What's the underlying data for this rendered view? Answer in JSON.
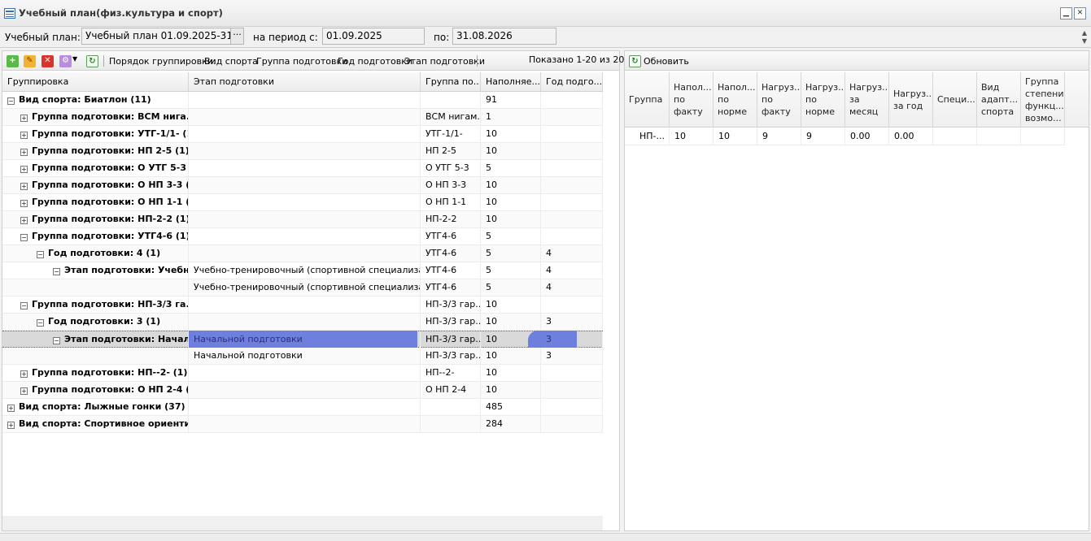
{
  "window": {
    "title": "Учебный план(физ.культура и спорт)",
    "min_label": "▁",
    "close_label": "✕"
  },
  "params": {
    "plan_label": "Учебный план:",
    "plan_value": "Учебный план 01.09.2025-31.08.2026",
    "dots_label": "···",
    "period_label": "на период с:",
    "date_from": "01.09.2025",
    "to_label": "по:",
    "date_to": "31.08.2026"
  },
  "left_toolbar": {
    "grouping_label": "Порядок группировки:",
    "groups": [
      "Вид спорта",
      "Группа подготовки",
      "Год подготовки",
      "Этап подготовки"
    ],
    "shown": "Показано 1-20 из 20"
  },
  "left_grid": {
    "headers": [
      "Группировка",
      "Этап подготовки",
      "Группа по...",
      "Наполняе...",
      "Год подго..."
    ],
    "rows": [
      {
        "lvl": 0,
        "exp": "−",
        "group": "Вид спорта: Биатлон (11)",
        "stage": "",
        "grp": "",
        "fill": "91",
        "year": ""
      },
      {
        "lvl": 1,
        "exp": "+",
        "group": "Группа подготовки: ВСМ нига...",
        "stage": "",
        "grp": "ВСМ нигам...",
        "fill": "1",
        "year": ""
      },
      {
        "lvl": 1,
        "exp": "+",
        "group": "Группа подготовки: УТГ-1/1- (1)",
        "stage": "",
        "grp": "УТГ-1/1-",
        "fill": "10",
        "year": ""
      },
      {
        "lvl": 1,
        "exp": "+",
        "group": "Группа подготовки: НП 2-5 (1)",
        "stage": "",
        "grp": "НП 2-5",
        "fill": "10",
        "year": ""
      },
      {
        "lvl": 1,
        "exp": "+",
        "group": "Группа подготовки: О УТГ 5-3 ...",
        "stage": "",
        "grp": "О УТГ 5-3",
        "fill": "5",
        "year": ""
      },
      {
        "lvl": 1,
        "exp": "+",
        "group": "Группа подготовки: О НП 3-3 (...",
        "stage": "",
        "grp": "О НП 3-3",
        "fill": "10",
        "year": ""
      },
      {
        "lvl": 1,
        "exp": "+",
        "group": "Группа подготовки: О НП 1-1 (...",
        "stage": "",
        "grp": "О НП 1-1",
        "fill": "10",
        "year": ""
      },
      {
        "lvl": 1,
        "exp": "+",
        "group": "Группа подготовки: НП-2-2 (1)",
        "stage": "",
        "grp": "НП-2-2",
        "fill": "10",
        "year": ""
      },
      {
        "lvl": 1,
        "exp": "−",
        "group": "Группа подготовки: УТГ4-6 (1)",
        "stage": "",
        "grp": "УТГ4-6",
        "fill": "5",
        "year": ""
      },
      {
        "lvl": 2,
        "exp": "−",
        "group": "Год подготовки: 4 (1)",
        "stage": "",
        "grp": "УТГ4-6",
        "fill": "5",
        "year": "4"
      },
      {
        "lvl": 3,
        "exp": "−",
        "group": "Этап подготовки: Учебн...",
        "stage": "Учебно-тренировочный (спортивной специализации)",
        "grp": "УТГ4-6",
        "fill": "5",
        "year": "4"
      },
      {
        "lvl": 4,
        "exp": "",
        "group": "",
        "stage": "Учебно-тренировочный (спортивной специализации)",
        "grp": "УТГ4-6",
        "fill": "5",
        "year": "4"
      },
      {
        "lvl": 1,
        "exp": "−",
        "group": "Группа подготовки: НП-3/3 га...",
        "stage": "",
        "grp": "НП-3/3 гар...",
        "fill": "10",
        "year": ""
      },
      {
        "lvl": 2,
        "exp": "−",
        "group": "Год подготовки: 3 (1)",
        "stage": "",
        "grp": "НП-3/3 гар...",
        "fill": "10",
        "year": "3"
      },
      {
        "lvl": 3,
        "exp": "−",
        "group": "Этап подготовки: Начал...",
        "stage": "Начальной подготовки",
        "grp": "НП-3/3 гар...",
        "fill": "10",
        "year": "3",
        "sel": true
      },
      {
        "lvl": 4,
        "exp": "",
        "group": "",
        "stage": "Начальной подготовки",
        "grp": "НП-3/3 гар...",
        "fill": "10",
        "year": "3"
      },
      {
        "lvl": 1,
        "exp": "+",
        "group": "Группа подготовки: НП--2- (1)",
        "stage": "",
        "grp": "НП--2-",
        "fill": "10",
        "year": ""
      },
      {
        "lvl": 1,
        "exp": "+",
        "group": "Группа подготовки: О НП 2-4 (...",
        "stage": "",
        "grp": "О НП 2-4",
        "fill": "10",
        "year": ""
      },
      {
        "lvl": 0,
        "exp": "+",
        "group": "Вид спорта: Лыжные гонки (37)",
        "stage": "",
        "grp": "",
        "fill": "485",
        "year": ""
      },
      {
        "lvl": 0,
        "exp": "+",
        "group": "Вид спорта: Спортивное ориенти...",
        "stage": "",
        "grp": "",
        "fill": "284",
        "year": ""
      }
    ]
  },
  "right_toolbar": {
    "refresh_label": "Обновить"
  },
  "right_grid": {
    "headers": [
      "Группа",
      "Напол... по факту",
      "Напол... по норме",
      "Нагруз... по факту",
      "Нагруз... по норме",
      "Нагруз... за месяц",
      "Нагруз... за год",
      "Специ...",
      "Вид адапт... спорта",
      "Группа степени функц... возмо..."
    ],
    "rows": [
      [
        "НП-...",
        "10",
        "10",
        "9",
        "9",
        "0.00",
        "0.00",
        "",
        "",
        ""
      ]
    ]
  }
}
